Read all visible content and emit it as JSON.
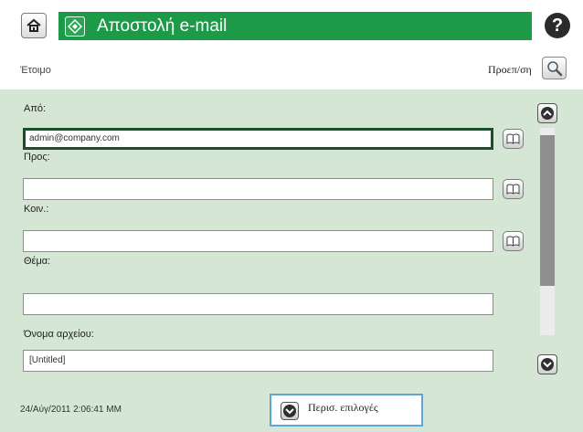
{
  "header": {
    "title": "Αποστολή e-mail",
    "home_icon": "home-icon",
    "app_icon": "send-email-icon",
    "help_icon": "help-icon",
    "help_glyph": "?",
    "accent_color": "#1d9a48"
  },
  "status": {
    "text": "Έτοιμο",
    "preview_label": "Προεπ/ση",
    "preview_icon": "magnifier-icon"
  },
  "form": {
    "fields": [
      {
        "label": "Από:",
        "value": "admin@company.com",
        "has_address_book": true,
        "focused": true
      },
      {
        "label": "Προς:",
        "value": "",
        "has_address_book": true,
        "focused": false
      },
      {
        "label": "Κοιν.:",
        "value": "",
        "has_address_book": true,
        "focused": false
      },
      {
        "label": "Θέμα:",
        "value": "",
        "has_address_book": false,
        "focused": false
      },
      {
        "label": "Όνομα αρχείου:",
        "value": "[Untitled]",
        "has_address_book": false,
        "focused": false
      }
    ],
    "address_book_icon": "address-book-icon"
  },
  "footer": {
    "timestamp": "24/Αύγ/2011 2:06:41 ΜΜ",
    "more_options_label": "Περισ. επιλογές"
  }
}
